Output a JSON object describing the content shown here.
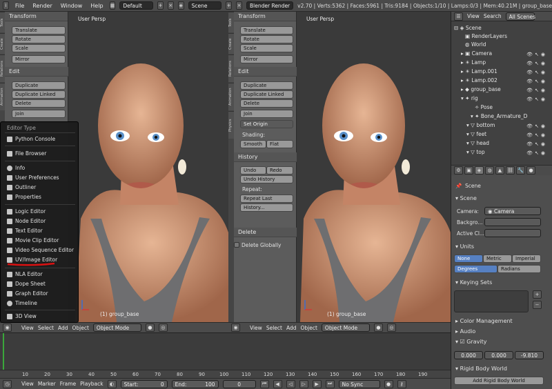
{
  "topbar": {
    "menus": [
      "File",
      "Render",
      "Window",
      "Help"
    ],
    "layout": "Default",
    "scene": "Scene",
    "engine": "Blender Render",
    "stats": "v2.70 | Verts:5362 | Faces:5961 | Tris:9184 | Objects:1/10 | Lamps:0/3 | Mem:40.21M | group_base"
  },
  "left_tabs": [
    "Tools",
    "Create",
    "Relations",
    "Animation",
    "Physics"
  ],
  "tool_panel": {
    "transform_header": "Transform",
    "translate": "Translate",
    "rotate": "Rotate",
    "scale": "Scale",
    "mirror": "Mirror",
    "edit_header": "Edit",
    "duplicate": "Duplicate",
    "duplicate_linked": "Duplicate Linked",
    "delete": "Delete",
    "join": "Join",
    "set_origin": "Set Origin",
    "shading_label": "Shading:",
    "smooth": "Smooth",
    "flat": "Flat",
    "history_header": "History",
    "undo": "Undo",
    "redo": "Redo",
    "undo_history": "Undo History",
    "repeat_label": "Repeat:",
    "repeat_last": "Repeat Last",
    "history_btn": "History...",
    "delete_header": "Delete",
    "delete_globally": "Delete Globally"
  },
  "viewport": {
    "label": "User Persp",
    "object_label": "(1) group_base",
    "header_menus": [
      "View",
      "Select",
      "Add",
      "Object"
    ],
    "mode": "Object Mode"
  },
  "editor_menu": {
    "title": "Editor Type",
    "groups": [
      [
        "Python Console"
      ],
      [
        "File Browser"
      ],
      [
        "Info",
        "User Preferences",
        "Outliner",
        "Properties"
      ],
      [
        "Logic Editor",
        "Node Editor",
        "Text Editor",
        "Movie Clip Editor",
        "Video Sequence Editor",
        "UV/Image Editor"
      ],
      [
        "NLA Editor",
        "Dope Sheet",
        "Graph Editor",
        "Timeline"
      ],
      [
        "3D View"
      ]
    ]
  },
  "outliner": {
    "header_menus": [
      "View",
      "Search"
    ],
    "filter": "All Scenes",
    "rows": [
      "Scene",
      "RenderLayers",
      "World",
      "Camera",
      "Lamp",
      "Lamp.001",
      "Lamp.002",
      "group_base",
      "rig",
      "Pose",
      "Bone_Armature_D",
      "bottom",
      "feet",
      "head",
      "top"
    ]
  },
  "properties": {
    "scene_name": "Scene",
    "scene_header": "Scene",
    "camera_label": "Camera:",
    "camera_value": "Camera",
    "background_label": "Backgro...",
    "active_clip_label": "Active Cl...",
    "units_header": "Units",
    "units_opts": [
      "None",
      "Metric",
      "Imperial"
    ],
    "angle_opts": [
      "Degrees",
      "Radians"
    ],
    "keying_header": "Keying Sets",
    "color_mgmt": "Color Management",
    "audio": "Audio",
    "gravity": "Gravity",
    "gravity_values": [
      "0.000",
      "0.000",
      "-9.810"
    ],
    "rigid_header": "Rigid Body World",
    "add_rigid": "Add Rigid Body World"
  },
  "timeline": {
    "ticks": [
      "10",
      "20",
      "30",
      "40",
      "50",
      "60",
      "70",
      "80",
      "90",
      "100",
      "110",
      "120",
      "130",
      "140",
      "150",
      "160",
      "170",
      "180",
      "190"
    ],
    "header_menus": [
      "View",
      "Marker",
      "Frame",
      "Playback"
    ],
    "start": "Start:",
    "start_value": "0",
    "end": "End:",
    "end_value": "100",
    "current": "0",
    "sync": "No Sync"
  },
  "colors": {
    "accent": "#5680c2",
    "annotation": "#e01010"
  }
}
